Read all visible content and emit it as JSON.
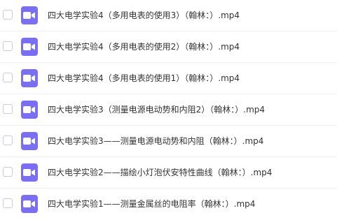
{
  "files": [
    {
      "name": "四大电学实验4（多用电表的使用3）（翰林：）.mp4",
      "icon": "video-icon"
    },
    {
      "name": "四大电学实验4（多用电表的使用2）（翰林：）.mp4",
      "icon": "video-icon"
    },
    {
      "name": "四大电学实验4（多用电表的使用1）（翰林：）.mp4",
      "icon": "video-icon"
    },
    {
      "name": "四大电学实验3（测量电源电动势和内阻2）（翰林：）.mp4",
      "icon": "video-icon"
    },
    {
      "name": "四大电学实验3——测量电源电动势和内阻（翰林：）.mp4",
      "icon": "video-icon"
    },
    {
      "name": "四大电学实验2——描绘小灯泡伏安特性曲线（翰林：）.mp4",
      "icon": "video-icon"
    },
    {
      "name": "四大电学实验1——测量金属丝的电阻率（翰林：）.mp4",
      "icon": "video-icon"
    }
  ],
  "colors": {
    "icon_background": "#7a6ff2",
    "text": "#333333",
    "divider": "#eef0f4"
  }
}
